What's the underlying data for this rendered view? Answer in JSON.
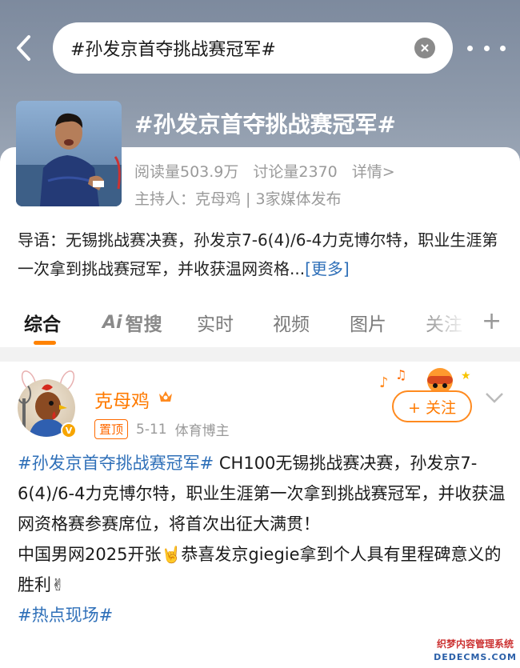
{
  "header": {
    "search_text": "#孙发京首夺挑战赛冠军#"
  },
  "topic": {
    "title": "#孙发京首夺挑战赛冠军#",
    "reads": "阅读量503.9万",
    "discussions": "讨论量2370",
    "detail_label": "详情>",
    "host": "主持人：克母鸡 | 3家媒体发布",
    "intro": "导语：无锡挑战赛决赛，孙发京7-6(4)/6-4力克博尔特，职业生涯第一次拿到挑战赛冠军，并收获温网资格...",
    "more_label": "[更多]"
  },
  "tabs": [
    {
      "label": "综合"
    },
    {
      "label": "智搜"
    },
    {
      "label": "实时"
    },
    {
      "label": "视频"
    },
    {
      "label": "图片"
    },
    {
      "label": "关注"
    }
  ],
  "tab_plus": "+",
  "post": {
    "author": "克母鸡",
    "pin_label": "置顶",
    "date": "5-11",
    "source": "体育博主",
    "follow_label": "+ 关注",
    "hashtag1": "#孙发京首夺挑战赛冠军#",
    "text1": " CH100无锡挑战赛决赛，孙发京7-6(4)/6-4力克博尔特，职业生涯第一次拿到挑战赛冠军，并收获温网资格赛参赛席位，将首次出征大满贯！",
    "text2": "中国男网2025开张",
    "emoji1": "🤘",
    "text3": "恭喜发京giegie拿到个人具有里程碑意义的胜利",
    "emoji2": "✌",
    "hashtag2": "#热点现场#"
  },
  "watermark": {
    "line1": "织梦内容管理系统",
    "line2": "DEDECMS.COM"
  },
  "colors": {
    "accent": "#ff8200",
    "link": "#2e6fb8",
    "hero": "#8e9aab"
  }
}
